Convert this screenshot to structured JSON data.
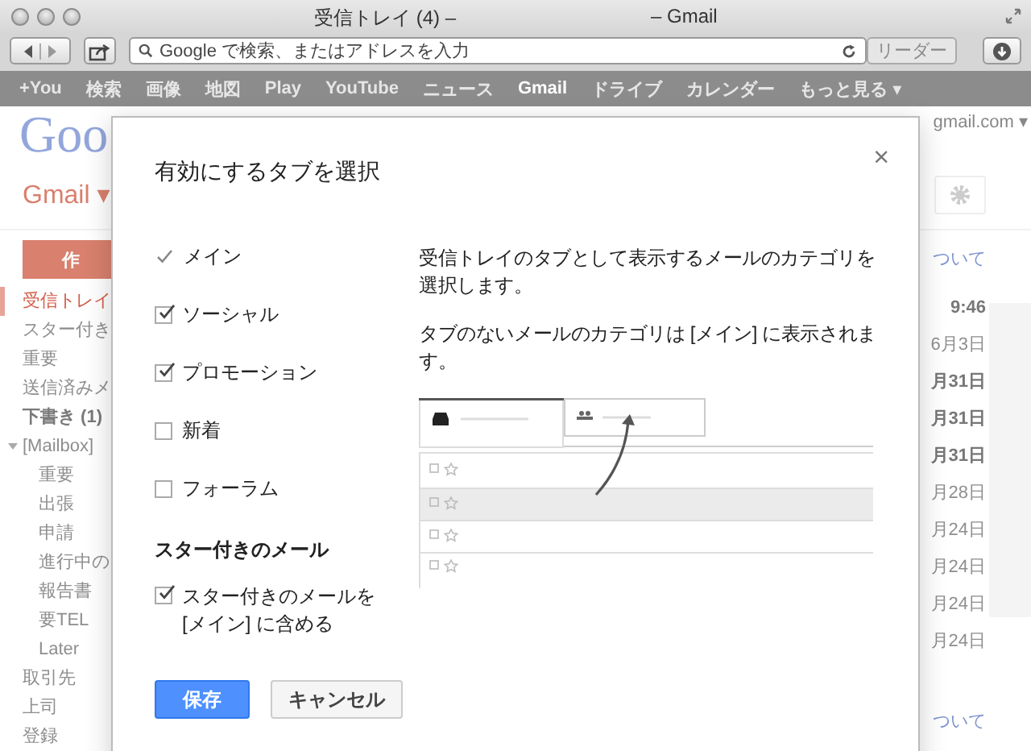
{
  "window": {
    "title_left": "受信トレイ (4) –",
    "title_right": "– Gmail"
  },
  "toolbar": {
    "address_placeholder": "Google で検索、またはアドレスを入力",
    "reader_button": {
      "label": "リーダー",
      "disabled": true
    }
  },
  "google_bar": [
    {
      "label": "+You",
      "selected": false
    },
    {
      "label": "検索",
      "selected": false
    },
    {
      "label": "画像",
      "selected": false
    },
    {
      "label": "地図",
      "selected": false
    },
    {
      "label": "Play",
      "selected": false
    },
    {
      "label": "YouTube",
      "selected": false
    },
    {
      "label": "ニュース",
      "selected": false
    },
    {
      "label": "Gmail",
      "selected": true
    },
    {
      "label": "ドライブ",
      "selected": false
    },
    {
      "label": "カレンダー",
      "selected": false
    },
    {
      "label": "もっと見る ▾",
      "selected": false
    }
  ],
  "background": {
    "logo": "Goo",
    "account": "gmail.com ▾",
    "app_menu": "Gmail ▾",
    "compose_button": "作",
    "link_top": "ついて",
    "link_bottom": "ついて",
    "sidebar": [
      {
        "label": "受信トレイ",
        "selected": true
      },
      {
        "label": "スター付き",
        "selected": false
      },
      {
        "label": "重要",
        "selected": false
      },
      {
        "label": "送信済みメ",
        "selected": false
      },
      {
        "label": "下書き (1)",
        "selected": false,
        "bold": true
      },
      {
        "label": "[Mailbox]",
        "selected": false,
        "expanded": true,
        "children": [
          {
            "label": "重要",
            "selected": false
          },
          {
            "label": "出張",
            "selected": false
          },
          {
            "label": "申請",
            "selected": false
          },
          {
            "label": "進行中の",
            "selected": false
          },
          {
            "label": "報告書",
            "selected": false
          },
          {
            "label": "要TEL",
            "selected": false
          },
          {
            "label": "Later",
            "selected": false
          }
        ]
      },
      {
        "label": "取引先",
        "selected": false
      },
      {
        "label": "上司",
        "selected": false
      },
      {
        "label": "登録",
        "selected": false
      }
    ],
    "dates": [
      {
        "text": "9:46",
        "unread": true
      },
      {
        "text": "6月3日",
        "unread": false
      },
      {
        "text": "月31日",
        "unread": true
      },
      {
        "text": "月31日",
        "unread": true
      },
      {
        "text": "月31日",
        "unread": true
      },
      {
        "text": "月28日",
        "unread": false
      },
      {
        "text": "月24日",
        "unread": false
      },
      {
        "text": "月24日",
        "unread": false
      },
      {
        "text": "月24日",
        "unread": false
      },
      {
        "text": "月24日",
        "unread": false
      }
    ]
  },
  "dialog": {
    "title": "有効にするタブを選択",
    "close": "×",
    "tabs": [
      {
        "kind": "fixed",
        "label": "メイン",
        "checked": true
      },
      {
        "kind": "checkbox",
        "label": "ソーシャル",
        "checked": true
      },
      {
        "kind": "checkbox",
        "label": "プロモーション",
        "checked": true
      },
      {
        "kind": "checkbox",
        "label": "新着",
        "checked": false
      },
      {
        "kind": "checkbox",
        "label": "フォーラム",
        "checked": false
      }
    ],
    "starred_heading": "スター付きのメール",
    "starred_option": {
      "label": "スター付きのメールを [メイン] に含める",
      "checked": true
    },
    "description": [
      "受信トレイのタブとして表示するメールのカテゴリを選択します。",
      "タブのないメールのカテゴリは [メイン] に表示されます。"
    ],
    "buttons": [
      {
        "kind": "primary",
        "label": "保存"
      },
      {
        "kind": "secondary",
        "label": "キャンセル"
      }
    ]
  }
}
